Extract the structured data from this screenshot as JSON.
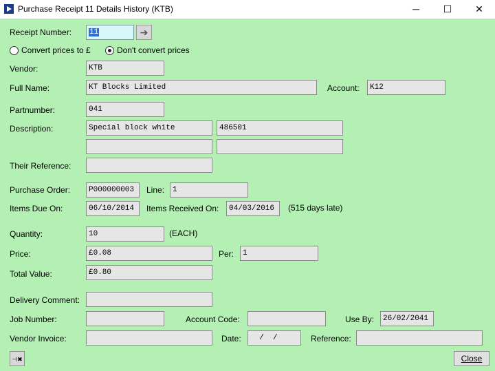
{
  "window": {
    "title": "Purchase Receipt 11 Details History (KTB)",
    "minimize_glyph": "─",
    "maximize_glyph": "☐",
    "close_glyph": "✕"
  },
  "receipt": {
    "label": "Receipt Number:",
    "value": "11",
    "go_icon": "➔"
  },
  "currency": {
    "convert_label": "Convert prices to £",
    "dont_convert_label": "Don't convert prices",
    "selected": "dont_convert"
  },
  "vendor": {
    "label": "Vendor:",
    "value": "KTB"
  },
  "full_name": {
    "label": "Full Name:",
    "value": "KT Blocks Limited"
  },
  "account": {
    "label": "Account:",
    "value": "K12"
  },
  "partnumber": {
    "label": "Partnumber:",
    "value": "041"
  },
  "description": {
    "label": "Description:",
    "line1a": "Special block white",
    "line1b": "486501",
    "line2a": "",
    "line2b": ""
  },
  "their_reference": {
    "label": "Their Reference:",
    "value": ""
  },
  "purchase_order": {
    "label": "Purchase Order:",
    "value": "P000000003"
  },
  "line": {
    "label": "Line:",
    "value": "1"
  },
  "items_due": {
    "label": "Items Due On:",
    "value": "06/10/2014"
  },
  "items_received": {
    "label": "Items Received On:",
    "value": "04/03/2016",
    "late_note": "(515 days late)"
  },
  "quantity": {
    "label": "Quantity:",
    "value": "10",
    "unit": "(EACH)"
  },
  "price": {
    "label": "Price:",
    "value": "£0.08"
  },
  "per": {
    "label": "Per:",
    "value": "1"
  },
  "total_value": {
    "label": "Total Value:",
    "value": "£0.80"
  },
  "delivery_comment": {
    "label": "Delivery Comment:",
    "value": ""
  },
  "job_number": {
    "label": "Job Number:",
    "value": ""
  },
  "account_code": {
    "label": "Account Code:",
    "value": ""
  },
  "use_by": {
    "label": "Use By:",
    "value": "26/02/2041"
  },
  "vendor_invoice": {
    "label": "Vendor Invoice:",
    "value": ""
  },
  "date": {
    "label": "Date:",
    "value": "  /  /"
  },
  "reference": {
    "label": "Reference:",
    "value": ""
  },
  "buttons": {
    "pin_icon": "⊣✖",
    "close_label": "Close"
  },
  "colors": {
    "background": "#b4f0b4",
    "field": "#e6e6e6",
    "active_field": "#d7f7fb",
    "selection": "#2f6fd8"
  }
}
